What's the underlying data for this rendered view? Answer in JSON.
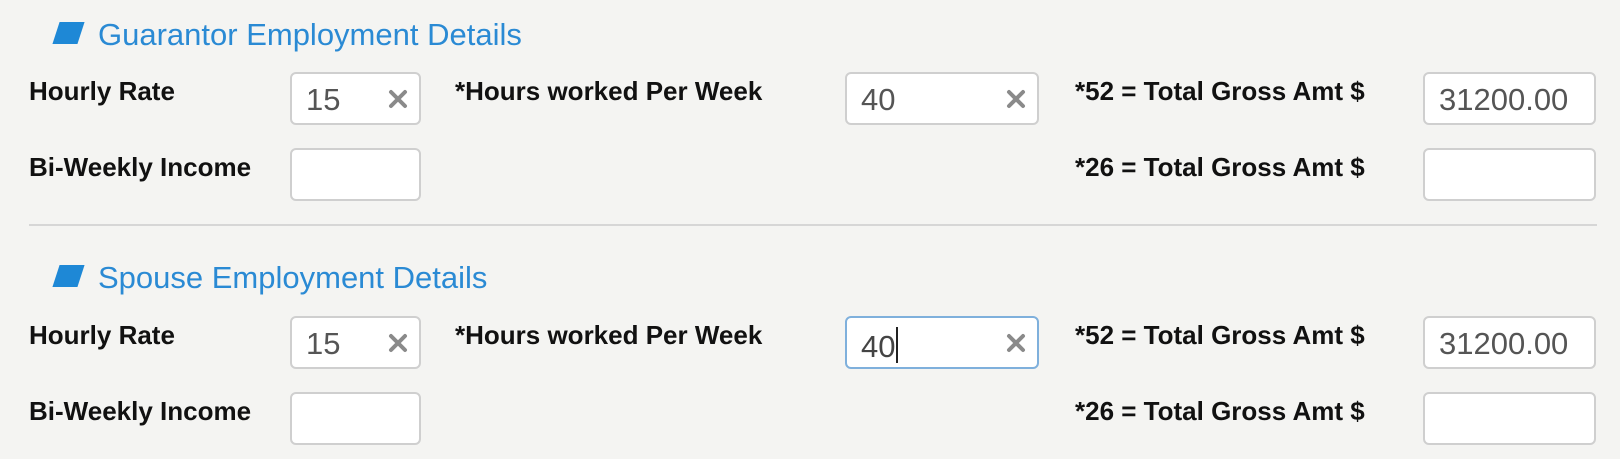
{
  "sections": [
    {
      "title": "Guarantor Employment Details",
      "hourly_rate_label": "Hourly Rate",
      "hourly_rate_value": "15",
      "hours_label": "*Hours worked Per Week",
      "hours_value": "40",
      "gross52_label": "*52 = Total Gross Amt $",
      "gross52_value": "31200.00",
      "biweekly_label": "Bi-Weekly Income",
      "biweekly_value": "",
      "gross26_label": "*26 = Total Gross Amt $",
      "gross26_value": ""
    },
    {
      "title": "Spouse Employment Details",
      "hourly_rate_label": "Hourly Rate",
      "hourly_rate_value": "15",
      "hours_label": "*Hours worked Per Week",
      "hours_value": "40",
      "gross52_label": "*52 = Total Gross Amt $",
      "gross52_value": "31200.00",
      "biweekly_label": "Bi-Weekly Income",
      "biweekly_value": "",
      "gross26_label": "*26 = Total Gross Amt $",
      "gross26_value": ""
    }
  ],
  "icons": {
    "section": "section-marker-icon",
    "clear": "clear-x-icon"
  },
  "colors": {
    "accent": "#1e88d6",
    "title": "#2a8ad4",
    "focus_border": "#7fb0dc"
  }
}
